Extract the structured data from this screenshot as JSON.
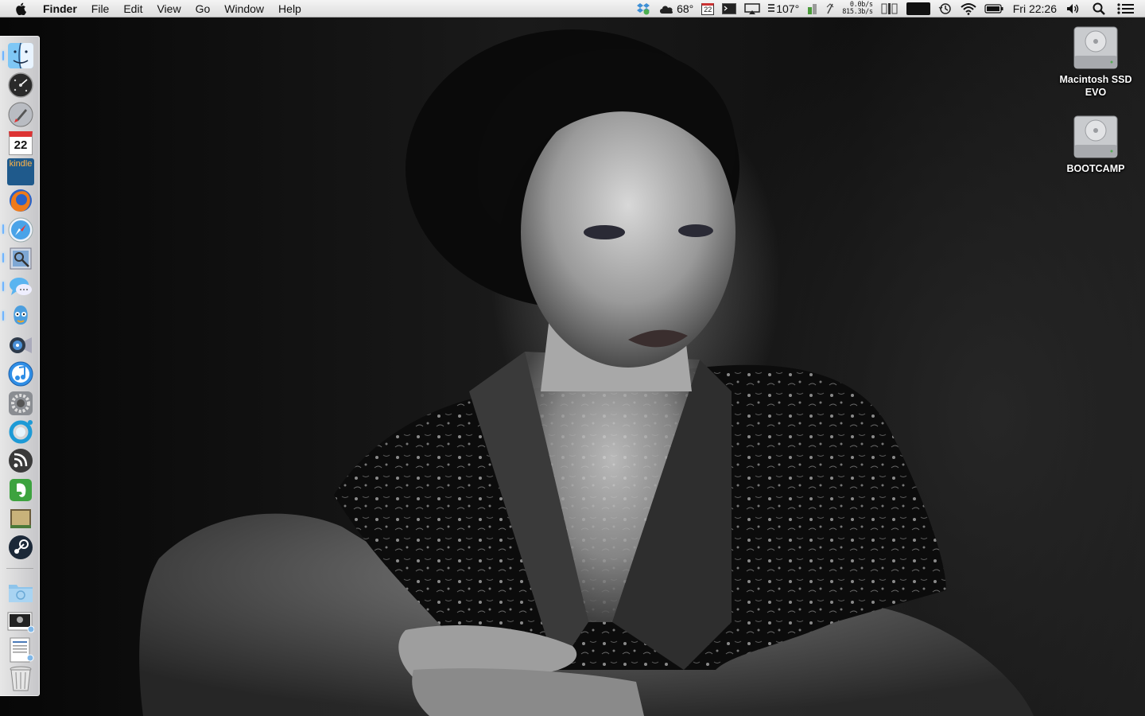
{
  "menubar": {
    "apple_icon": "apple-logo-icon",
    "app_name": "Finder",
    "menus": [
      "File",
      "Edit",
      "View",
      "Go",
      "Window",
      "Help"
    ],
    "status": {
      "weather_temp": "68°",
      "calendar_day": "22",
      "cpu_temp": "107°",
      "net_down": "0.0b/s",
      "net_up": "815.3b/s",
      "clock": "Fri 22:26"
    }
  },
  "dock": {
    "items": [
      {
        "name": "finder",
        "icon": "finder-icon",
        "running": true
      },
      {
        "name": "dashboard",
        "icon": "dashboard-icon",
        "running": false
      },
      {
        "name": "launchpad",
        "icon": "launchpad-icon",
        "running": false
      },
      {
        "name": "calendar",
        "icon": "calendar-icon",
        "running": false,
        "label": "22"
      },
      {
        "name": "kindle",
        "icon": "kindle-icon",
        "running": false,
        "label": "kindle"
      },
      {
        "name": "firefox",
        "icon": "firefox-icon",
        "running": false
      },
      {
        "name": "safari",
        "icon": "safari-icon",
        "running": true
      },
      {
        "name": "preview",
        "icon": "preview-icon",
        "running": true
      },
      {
        "name": "messages",
        "icon": "messages-icon",
        "running": true
      },
      {
        "name": "tweetbot",
        "icon": "tweetbot-icon",
        "running": true
      },
      {
        "name": "quicktime",
        "icon": "quicktime-icon",
        "running": false
      },
      {
        "name": "itunes",
        "icon": "itunes-icon",
        "running": false
      },
      {
        "name": "system-preferences",
        "icon": "gear-icon",
        "running": false
      },
      {
        "name": "sync",
        "icon": "sync-ring-icon",
        "running": false
      },
      {
        "name": "rss-reader",
        "icon": "rss-icon",
        "running": false
      },
      {
        "name": "evernote",
        "icon": "evernote-icon",
        "running": false
      },
      {
        "name": "book-app",
        "icon": "book-icon",
        "running": false
      },
      {
        "name": "steam",
        "icon": "steam-icon",
        "running": false
      }
    ],
    "stack_items": [
      {
        "name": "applications-folder",
        "icon": "folder-icon"
      },
      {
        "name": "downloads-stack",
        "icon": "image-stack-icon"
      },
      {
        "name": "documents-stack",
        "icon": "document-stack-icon"
      },
      {
        "name": "trash",
        "icon": "trash-icon"
      }
    ]
  },
  "desktop": {
    "icons": [
      {
        "label": "Macintosh SSD EVO",
        "icon": "hard-drive-icon"
      },
      {
        "label": "BOOTCAMP",
        "icon": "hard-drive-icon"
      }
    ]
  }
}
